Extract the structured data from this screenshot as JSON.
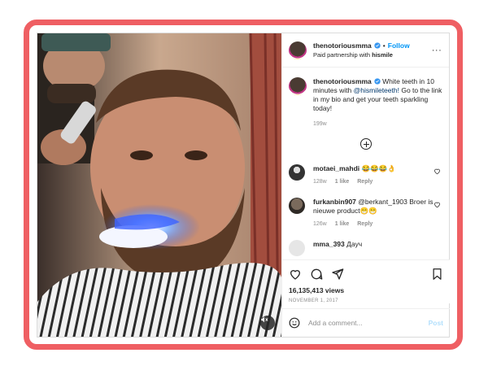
{
  "header": {
    "username": "thenotoriousmma",
    "follow_label": "Follow",
    "dot": "•",
    "partnership_prefix": "Paid partnership with ",
    "partner": "hismile",
    "more": "···"
  },
  "caption": {
    "username": "thenotoriousmma",
    "text_before": " White teeth in 10 minutes with ",
    "mention": "@hismileteeth!",
    "text_after": " Go to the link in my bio and get your teeth sparkling today!",
    "age": "199w"
  },
  "comments": [
    {
      "username": "motaei_mahdi",
      "text": " 😂😂😂👌",
      "age": "128w",
      "likes": "1 like",
      "reply": "Reply"
    },
    {
      "username": "furkanbin907",
      "text": " @berkant_1903 Broer is nieuwe product😁😁",
      "age": "126w",
      "likes": "1 like",
      "reply": "Reply"
    },
    {
      "username": "mma_393",
      "text": " Дауч"
    }
  ],
  "actions": {
    "views": "16,135,413 views",
    "date": "NOVEMBER 1, 2017"
  },
  "add_comment": {
    "placeholder": "Add a comment...",
    "post_label": "Post"
  },
  "colors": {
    "frame_border": "#ef5f63",
    "link_blue": "#0095f6",
    "verified_blue": "#3897f0",
    "glow": "#6fa8ff"
  },
  "icons": [
    "verified-badge-icon",
    "more-options-icon",
    "add-comment-icon",
    "heart-icon",
    "comment-icon",
    "share-icon",
    "bookmark-icon",
    "emoji-icon",
    "mute-icon"
  ]
}
